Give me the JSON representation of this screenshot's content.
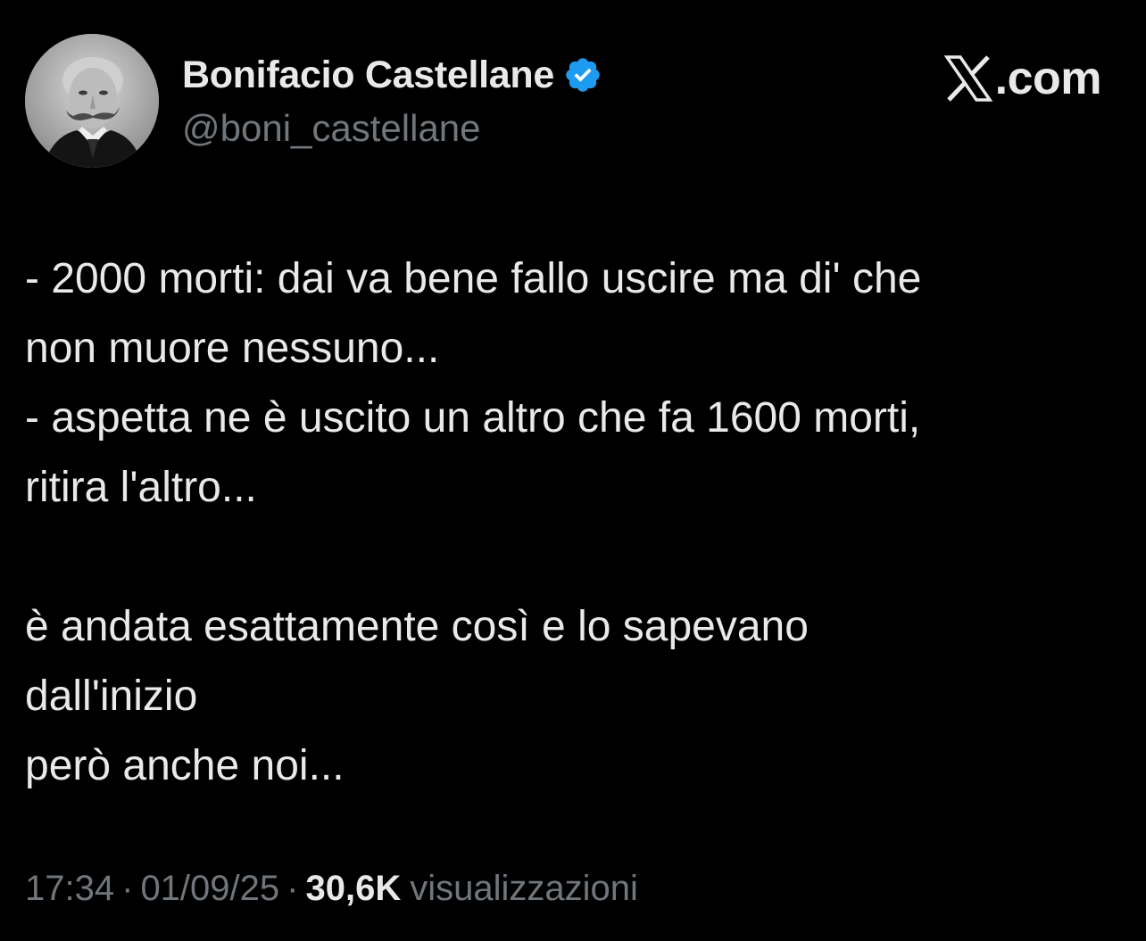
{
  "author": {
    "display_name": "Bonifacio Castellane",
    "handle": "@boni_castellane",
    "verified": true,
    "verified_color": "#1d9bf0"
  },
  "brand": {
    "text": ".com",
    "logo_icon": "x-logo-icon"
  },
  "tweet": {
    "lines": [
      "- 2000 morti: dai va bene fallo uscire ma di' che",
      "non muore nessuno...",
      "- aspetta ne è uscito un altro che fa 1600 morti,",
      "ritira l'altro...",
      "",
      "è andata esattamente così e lo sapevano",
      "dall'inizio",
      "però anche noi..."
    ]
  },
  "meta": {
    "time": "17:34",
    "separator": "·",
    "date": "01/09/25",
    "views_count": "30,6K",
    "views_label": "visualizzazioni"
  },
  "colors": {
    "background": "#000000",
    "text_primary": "#e7e9ea",
    "text_secondary": "#71767b",
    "verified_blue": "#1d9bf0"
  }
}
